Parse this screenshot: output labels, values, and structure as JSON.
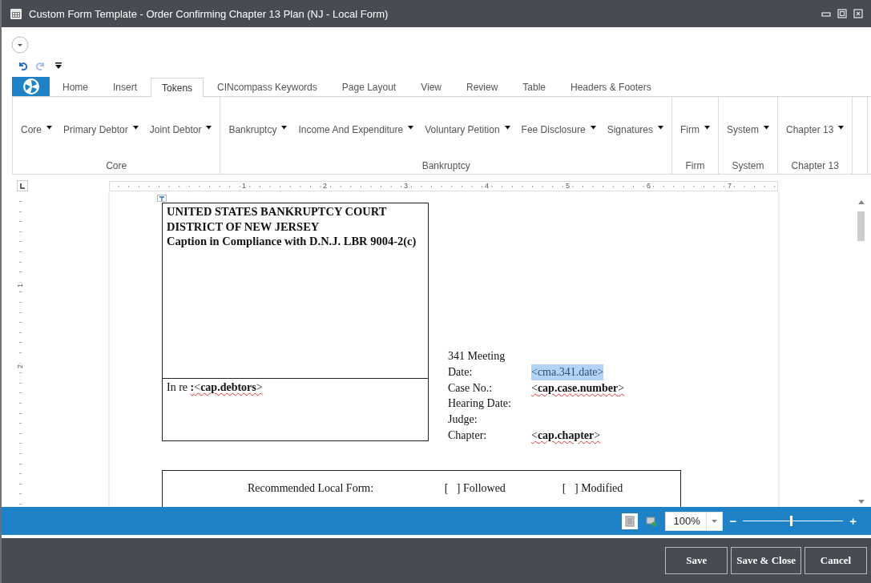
{
  "window": {
    "title": "Custom Form Template - Order Confirming Chapter 13 Plan (NJ - Local Form)"
  },
  "tabs": [
    {
      "label": "Home",
      "selected": false
    },
    {
      "label": "Insert",
      "selected": false
    },
    {
      "label": "Tokens",
      "selected": true
    },
    {
      "label": "CINcompass Keywords",
      "selected": false
    },
    {
      "label": "Page Layout",
      "selected": false
    },
    {
      "label": "View",
      "selected": false
    },
    {
      "label": "Review",
      "selected": false
    },
    {
      "label": "Table",
      "selected": false
    },
    {
      "label": "Headers & Footers",
      "selected": false
    }
  ],
  "ribbon": {
    "groups": [
      {
        "label": "Core",
        "items": [
          "Core",
          "Primary Debtor",
          "Joint Debtor"
        ]
      },
      {
        "label": "Bankruptcy",
        "items": [
          "Bankruptcy",
          "Income And Expenditure",
          "Voluntary Petition",
          "Fee Disclosure",
          "Signatures"
        ]
      },
      {
        "label": "Firm",
        "items": [
          "Firm"
        ]
      },
      {
        "label": "System",
        "items": [
          "System"
        ]
      },
      {
        "label": "Chapter 13",
        "items": [
          "Chapter 13"
        ]
      }
    ]
  },
  "ruler": {
    "marks": [
      "1",
      "2",
      "3",
      "4",
      "5",
      "6",
      "7"
    ]
  },
  "vertical_ruler": {
    "marks": [
      "1",
      "2"
    ]
  },
  "document": {
    "caption_lines": [
      "UNITED STATES BANKRUPTCY COURT",
      "DISTRICT OF NEW JERSEY",
      "Caption in Compliance with D.N.J. LBR 9004-2(c)"
    ],
    "in_re": {
      "label": "In re",
      "value": "**:**<**cap.debtors**>",
      "spell_error": true
    },
    "fields": [
      {
        "label": "341 Meeting Date:",
        "value": "<cma.341.date>",
        "selected": true,
        "spell_error": false
      },
      {
        "label": "Case No.:",
        "value": "<**cap.case.number**>",
        "selected": false,
        "spell_error": true
      },
      {
        "label": "Hearing Date:"
      },
      {
        "label": "Judge:"
      },
      {
        "label": "Chapter:",
        "value": "<**cap.chapter**>",
        "selected": false,
        "spell_error": true
      }
    ],
    "local_form": {
      "label": "Recommended Local Form:",
      "options": [
        "[   ] Followed",
        "[   ] Modified"
      ]
    }
  },
  "status_bar": {
    "zoom": "100%",
    "zoom_out": "−",
    "zoom_in": "+",
    "zoom_slider": {
      "level": 0.48
    }
  },
  "buttons": [
    "Save",
    "Save & Close",
    "Cancel"
  ]
}
